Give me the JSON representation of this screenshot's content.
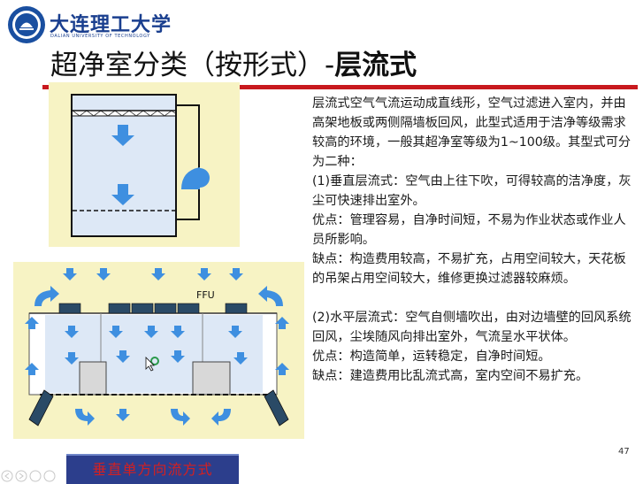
{
  "header": {
    "university_cn": "大连理工大学",
    "university_en": "DALIAN UNIVERSITY OF TECHNOLOGY",
    "title_prefix": "超净室分类（按形式）-",
    "title_emphasis": "层流式"
  },
  "body": {
    "intro": "层流式空气气流运动成直线形，空气过滤进入室内，并由高架地板或两侧隔墙板回风，此型式适用于洁净等级需求较高的环境，一般其超净室等级为1~100级。其型式可分为二种：",
    "vertical_heading": "(1)垂直层流式：空气由上往下吹，可得较高的洁净度，灰尘可快速排出室外。",
    "vertical_pros": "优点：管理容易，自净时间短，不易为作业状态或作业人员所影响。",
    "vertical_cons": "缺点：构造费用较高，不易扩充，占用空间较大，天花板的吊架占用空间较大，维修更换过滤器较麻烦。",
    "horizontal_heading": "(2)水平层流式：空气自侧墙吹出，由对边墙壁的回风系统回风，尘埃随风向排出室外，气流呈水平状体。",
    "horizontal_pros": "优点：构造简单，运转稳定，自净时间短。",
    "horizontal_cons": "缺点：建造费用比乱流式高，室内空间不易扩充。"
  },
  "figure2": {
    "ffu_label": "FFU"
  },
  "caption": "垂直单方向流方式",
  "page_number": "47",
  "colors": {
    "accent_red": "#c8191e",
    "figure_bg": "#f7f3c4",
    "room_blue": "#dde8f6",
    "arrow_blue": "#3e8fe0",
    "brand_blue": "#1a3f8f",
    "caption_bg": "#2c3e8c"
  }
}
